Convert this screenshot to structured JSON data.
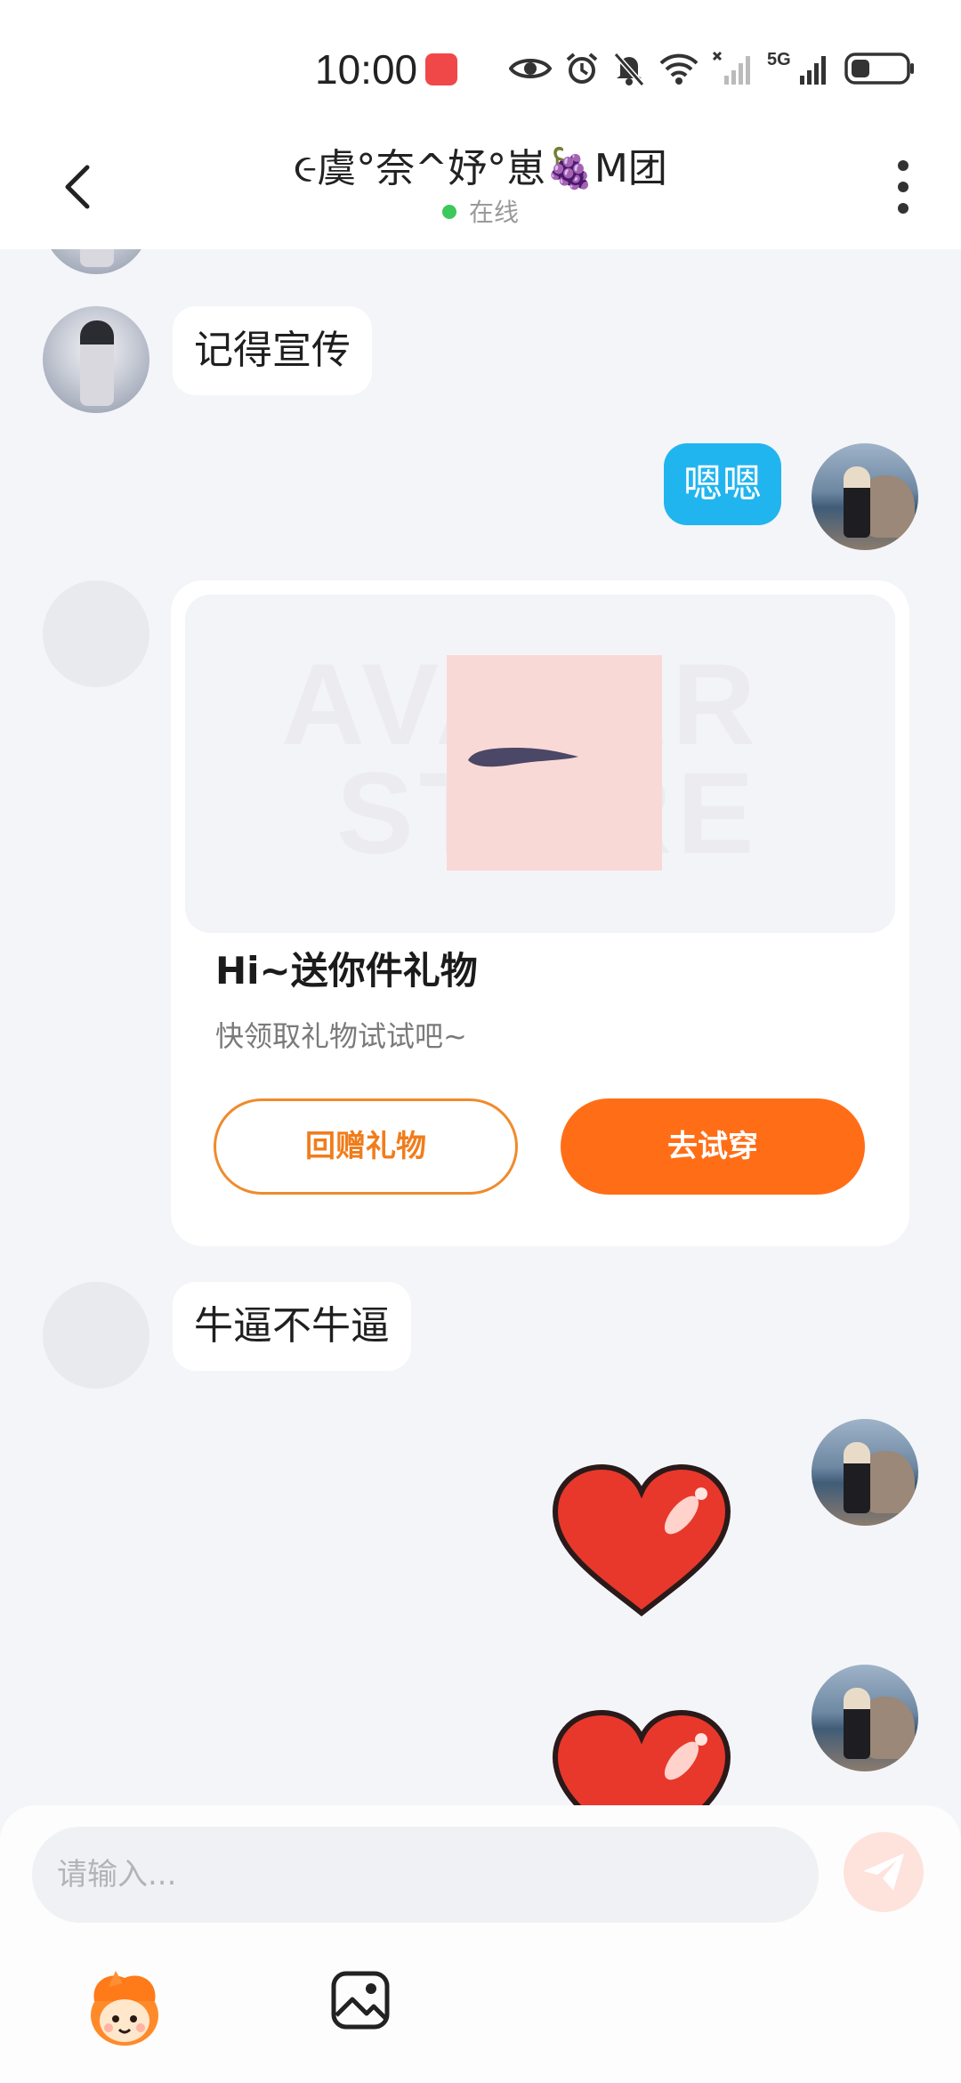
{
  "status_bar": {
    "time": "10:00",
    "signal_label": "5G",
    "icons": [
      "huawei-app-icon",
      "eye-icon",
      "alarm-icon",
      "mute-icon",
      "wifi-icon",
      "signal-x-icon",
      "signal-5g-icon",
      "battery-icon"
    ]
  },
  "header": {
    "title": "૯虞°奈^妤°崽🍇M团",
    "status": "在线",
    "back_icon": "chevron-left-icon",
    "more_icon": "more-vertical-icon"
  },
  "messages": [
    {
      "side": "left",
      "type": "text",
      "text": "记得宣传"
    },
    {
      "side": "right",
      "type": "text",
      "text": "嗯嗯"
    },
    {
      "side": "left",
      "type": "gift-card",
      "watermark_line1": "AVATAR",
      "watermark_line2": "STORE",
      "title": "Hi~送你件礼物",
      "subtitle": "快领取礼物试试吧~",
      "return_gift_label": "回赠礼物",
      "try_on_label": "去试穿"
    },
    {
      "side": "left",
      "type": "text",
      "text": "牛逼不牛逼"
    },
    {
      "side": "right",
      "type": "sticker",
      "icon": "heart-icon"
    },
    {
      "side": "right",
      "type": "sticker",
      "icon": "heart-icon"
    }
  ],
  "input_bar": {
    "placeholder": "请输入...",
    "value": "",
    "send_icon": "send-icon",
    "emoji_icon": "emoji-icon",
    "image_icon": "image-icon"
  },
  "colors": {
    "accent_orange": "#ff6e17",
    "bubble_blue": "#21b5ef",
    "online_green": "#3cc85a",
    "background": "#f4f5f9"
  }
}
